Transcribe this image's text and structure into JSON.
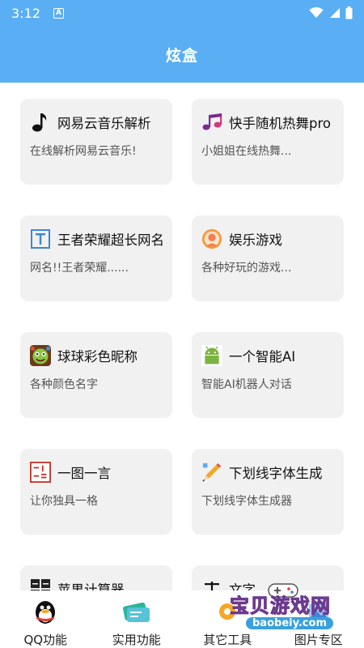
{
  "status_bar": {
    "time": "3:12",
    "badge": "A"
  },
  "app_bar": {
    "title": "炫盒"
  },
  "cards": [
    {
      "title": "网易云音乐解析",
      "desc": "在线解析网易云音乐!",
      "icon": "music-note-icon"
    },
    {
      "title": "快手随机热舞pro",
      "desc": "小姐姐在线热舞...",
      "icon": "music-notes-icon"
    },
    {
      "title": "王者荣耀超长网名",
      "desc": "网名!!王者荣耀......",
      "icon": "text-t-icon"
    },
    {
      "title": "娱乐游戏",
      "desc": "各种好玩的游戏...",
      "icon": "game-face-icon"
    },
    {
      "title": "球球彩色昵称",
      "desc": "各种颜色名字",
      "icon": "ball-monster-icon"
    },
    {
      "title": "一个智能AI",
      "desc": "智能AI机器人对话",
      "icon": "android-icon"
    },
    {
      "title": "一图一言",
      "desc": "让你独具一格",
      "icon": "seal-stamp-icon"
    },
    {
      "title": "下划线字体生成",
      "desc": "下划线字体生成器",
      "icon": "pencil-icon"
    },
    {
      "title": "苹果计算器",
      "desc": "",
      "icon": "calculator-icon"
    },
    {
      "title": "文字",
      "desc": "",
      "icon": "text-icon"
    }
  ],
  "bottom_nav": [
    {
      "label": "QQ功能",
      "icon": "qq-penguin-icon"
    },
    {
      "label": "实用功能",
      "icon": "tickets-icon"
    },
    {
      "label": "其它工具",
      "icon": "tools-icon"
    },
    {
      "label": "图片专区",
      "icon": "image-icon"
    }
  ],
  "watermark": {
    "text": "宝贝游戏网",
    "url": "baobeiy.com"
  },
  "colors": {
    "primary": "#5aaff4",
    "card_bg": "#f1f1f1"
  }
}
